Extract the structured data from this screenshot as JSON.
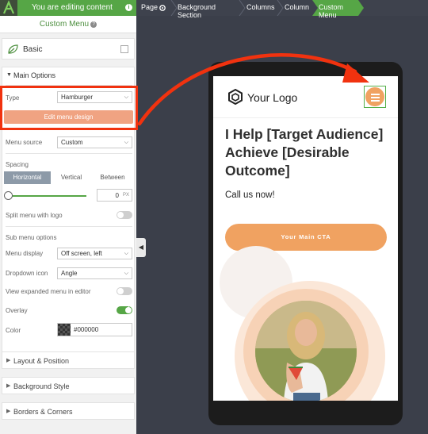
{
  "topbar": {
    "banner_text": "You are editing content",
    "info_glyph": "i",
    "breadcrumb": [
      "Page",
      "Background Section",
      "Columns",
      "Column",
      "Custom Menu"
    ]
  },
  "panel": {
    "title": "Custom Menu",
    "help_glyph": "?",
    "basic_label": "Basic",
    "main_options": {
      "heading": "Main Options",
      "type_label": "Type",
      "type_value": "Hamburger",
      "edit_button": "Edit menu design",
      "menu_source_label": "Menu source",
      "menu_source_value": "Custom",
      "spacing_label": "Spacing",
      "spacing_tabs": [
        "Horizontal",
        "Vertical",
        "Between"
      ],
      "spacing_value": "0",
      "spacing_unit": "PX",
      "split_label": "Split menu with logo",
      "split_on": false,
      "sub_menu_heading": "Sub menu options",
      "menu_display_label": "Menu display",
      "menu_display_value": "Off screen, left",
      "dropdown_icon_label": "Dropdown icon",
      "dropdown_icon_value": "Angle",
      "view_expanded_label": "View expanded menu in editor",
      "view_expanded_on": false,
      "overlay_label": "Overlay",
      "overlay_on": true,
      "color_label": "Color",
      "color_value": "#000000"
    },
    "sections": [
      "Layout & Position",
      "Background Style",
      "Borders & Corners"
    ]
  },
  "preview": {
    "logo_text": "Your Logo",
    "heading": "I Help [Target Audience] Achieve [Desirable Outcome]",
    "subheading": "Call us now!",
    "cta_label": "Your Main CTA"
  },
  "colors": {
    "accent_green": "#56a646",
    "orange": "#f0a261",
    "highlight_red": "#f1320f"
  }
}
